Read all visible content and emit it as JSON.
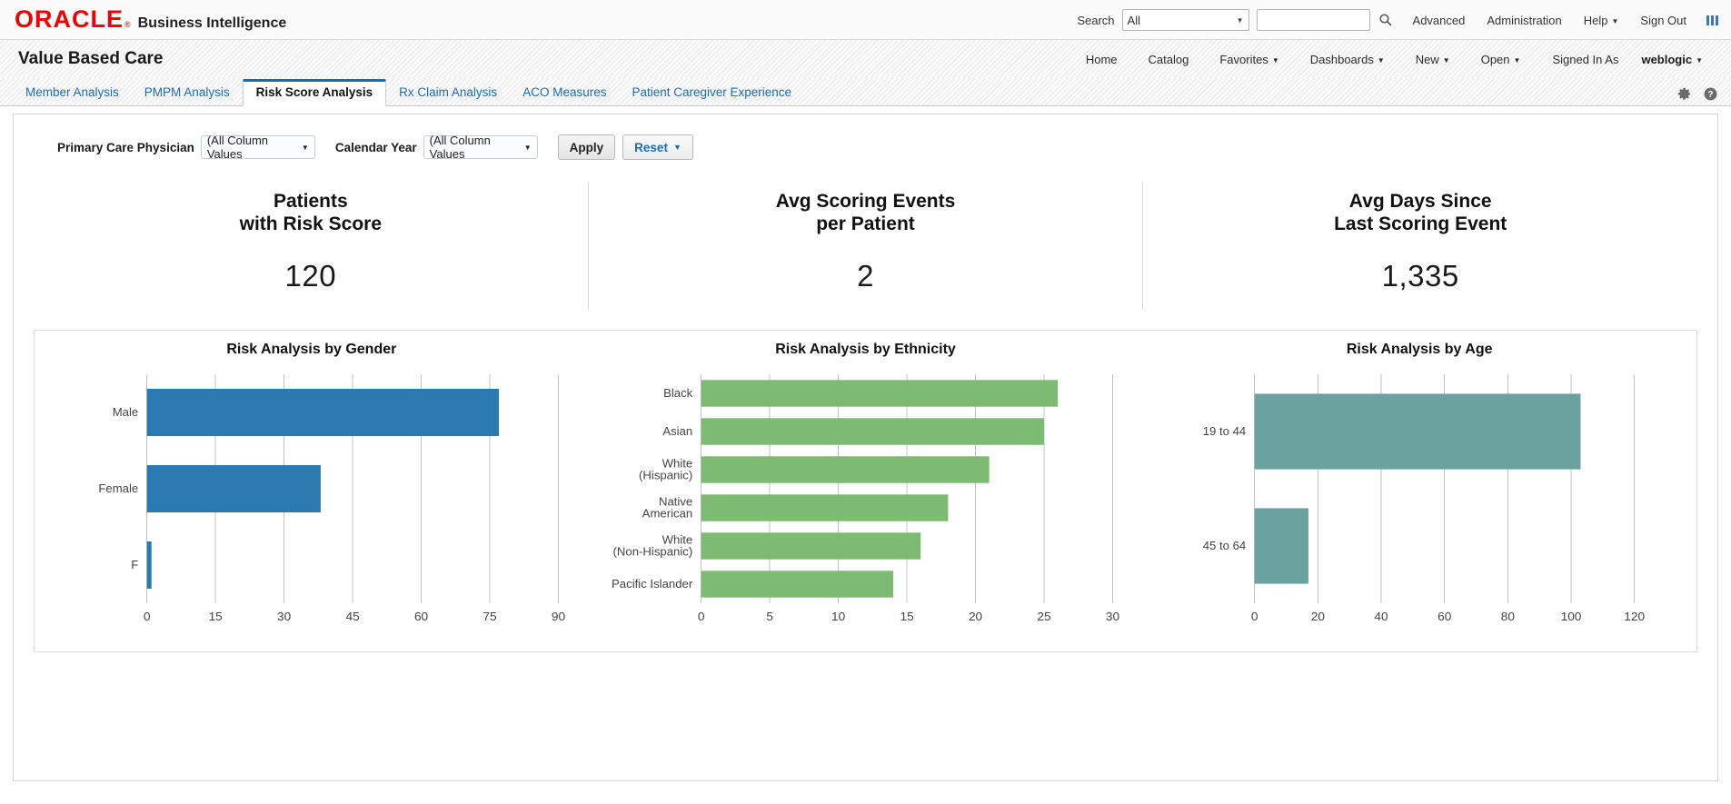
{
  "global_header": {
    "logo_text": "ORACLE",
    "logo_reg": "®",
    "product": "Business Intelligence",
    "search_label": "Search",
    "search_scope_value": "All",
    "search_input_value": "",
    "search_input_placeholder": "",
    "search_icon": "search-icon",
    "links": [
      {
        "label": "Advanced",
        "has_caret": false
      },
      {
        "label": "Administration",
        "has_caret": false
      },
      {
        "label": "Help",
        "has_caret": true
      },
      {
        "label": "Sign Out",
        "has_caret": false
      }
    ],
    "apps_icon": "grid-apps-icon"
  },
  "dashboard_bar": {
    "title": "Value Based Care",
    "nav": [
      {
        "label": "Home",
        "has_caret": false
      },
      {
        "label": "Catalog",
        "has_caret": false
      },
      {
        "label": "Favorites",
        "has_caret": true
      },
      {
        "label": "Dashboards",
        "has_caret": true
      },
      {
        "label": "New",
        "has_caret": true
      },
      {
        "label": "Open",
        "has_caret": true
      }
    ],
    "signed_in_label": "Signed In As",
    "user": "weblogic"
  },
  "tabs": {
    "items": [
      {
        "label": "Member Analysis",
        "active": false
      },
      {
        "label": "PMPM Analysis",
        "active": false
      },
      {
        "label": "Risk Score Analysis",
        "active": true
      },
      {
        "label": "Rx Claim Analysis",
        "active": false
      },
      {
        "label": "ACO Measures",
        "active": false
      },
      {
        "label": "Patient Caregiver Experience",
        "active": false
      }
    ],
    "gear_icon": "gear-icon",
    "help_icon": "help-icon"
  },
  "prompts": {
    "physician_label": "Primary Care Physician",
    "physician_value": "(All Column Values",
    "year_label": "Calendar Year",
    "year_value": "(All Column Values",
    "apply_label": "Apply",
    "reset_label": "Reset"
  },
  "kpis": [
    {
      "title": "Patients\nwith Risk Score",
      "value": "120"
    },
    {
      "title": "Avg Scoring Events\nper Patient",
      "value": "2"
    },
    {
      "title": "Avg Days Since\nLast Scoring Event",
      "value": "1,335"
    }
  ],
  "colors": {
    "bar_blue": "#2a7ab0",
    "bar_green": "#7dbb72",
    "bar_teal": "#6aa2a0",
    "accent_blue": "#1f6bb0",
    "oracle_red": "#f00000"
  },
  "chart_data": [
    {
      "type": "bar",
      "orientation": "horizontal",
      "title": "Risk Analysis by Gender",
      "categories": [
        "Male",
        "Female",
        "F"
      ],
      "values": [
        77,
        38,
        1
      ],
      "xlabel": "",
      "ylabel": "",
      "xlim": [
        0,
        90
      ],
      "xticks": [
        0,
        15,
        30,
        45,
        60,
        75,
        90
      ],
      "grid": true,
      "color": "#2a7ab0",
      "legend": "none"
    },
    {
      "type": "bar",
      "orientation": "horizontal",
      "title": "Risk Analysis by Ethnicity",
      "categories": [
        "Black",
        "Asian",
        "White\n(Hispanic)",
        "Native\nAmerican",
        "White\n(Non-Hispanic)",
        "Pacific Islander"
      ],
      "values": [
        26,
        25,
        21,
        18,
        16,
        14
      ],
      "xlabel": "",
      "ylabel": "",
      "xlim": [
        0,
        30
      ],
      "xticks": [
        0,
        5,
        10,
        15,
        20,
        25,
        30
      ],
      "grid": true,
      "color": "#7dbb72",
      "legend": "none"
    },
    {
      "type": "bar",
      "orientation": "horizontal",
      "title": "Risk Analysis by Age",
      "categories": [
        "19 to 44",
        "45 to 64"
      ],
      "values": [
        103,
        17
      ],
      "xlabel": "",
      "ylabel": "",
      "xlim": [
        0,
        130
      ],
      "xticks": [
        0,
        20,
        40,
        60,
        80,
        100,
        120
      ],
      "grid": true,
      "color": "#6aa2a0",
      "legend": "none"
    }
  ]
}
